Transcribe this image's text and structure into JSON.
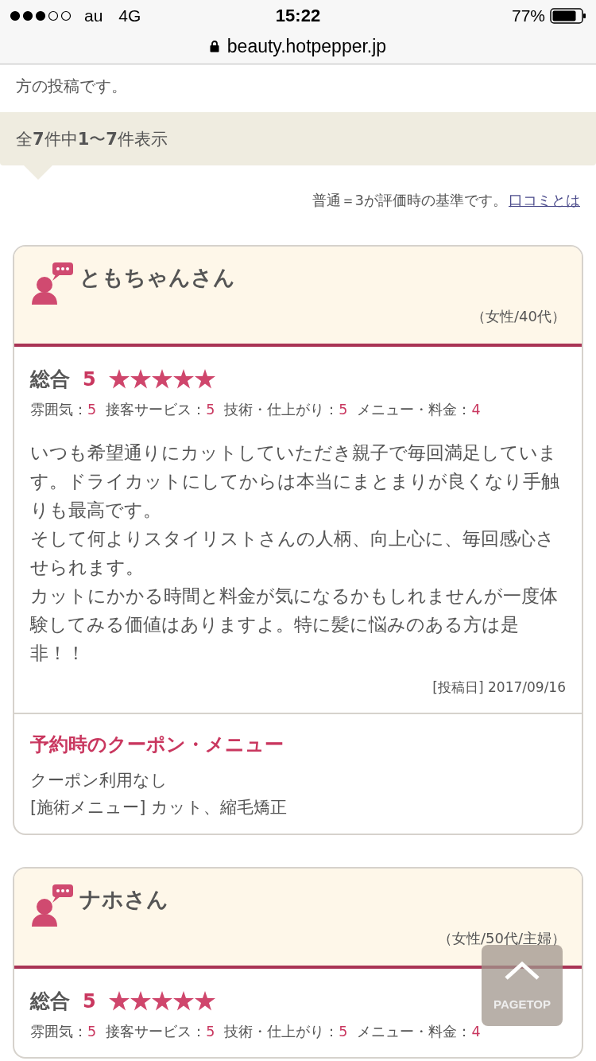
{
  "status_bar": {
    "carrier": "au",
    "network": "4G",
    "time": "15:22",
    "battery": "77%"
  },
  "browser": {
    "url": "beauty.hotpepper.jp"
  },
  "intro_tail": "方の投稿です。",
  "count_text": "全**7**件中**1**〜**7**件表示",
  "criteria": {
    "text": "普通＝3が評価時の基準です。",
    "link": "口コミとは"
  },
  "reviews": [
    {
      "name": "ともちゃんさん",
      "profile": "（女性/40代）",
      "overall_label": "総合",
      "overall": "5",
      "stars": 5,
      "ratings": [
        {
          "label": "雰囲気：",
          "value": "5"
        },
        {
          "label": "接客サービス：",
          "value": "5"
        },
        {
          "label": "技術・仕上がり：",
          "value": "5"
        },
        {
          "label": "メニュー・料金：",
          "value": "4"
        }
      ],
      "paragraphs": [
        "いつも希望通りにカットしていただき親子で毎回満足しています。ドライカットにしてからは本当にまとまりが良くなり手触りも最高です。",
        "そして何よりスタイリストさんの人柄、向上心に、毎回感心させられます。",
        "カットにかかる時間と料金が気になるかもしれませんが一度体験してみる価値はありますよ。特に髪に悩みのある方は是非！！"
      ],
      "date": "[投稿日] 2017/09/16",
      "coupon": {
        "title": "予約時のクーポン・メニュー",
        "lines": [
          "クーポン利用なし",
          "[施術メニュー] カット、縮毛矯正"
        ]
      }
    },
    {
      "name": "ナホさん",
      "profile": "（女性/50代/主婦）",
      "overall_label": "総合",
      "overall": "5",
      "stars": 5,
      "ratings": [
        {
          "label": "雰囲気：",
          "value": "5"
        },
        {
          "label": "接客サービス：",
          "value": "5"
        },
        {
          "label": "技術・仕上がり：",
          "value": "5"
        },
        {
          "label": "メニュー・料金：",
          "value": "4"
        }
      ]
    }
  ],
  "pagetop": "PAGETOP"
}
